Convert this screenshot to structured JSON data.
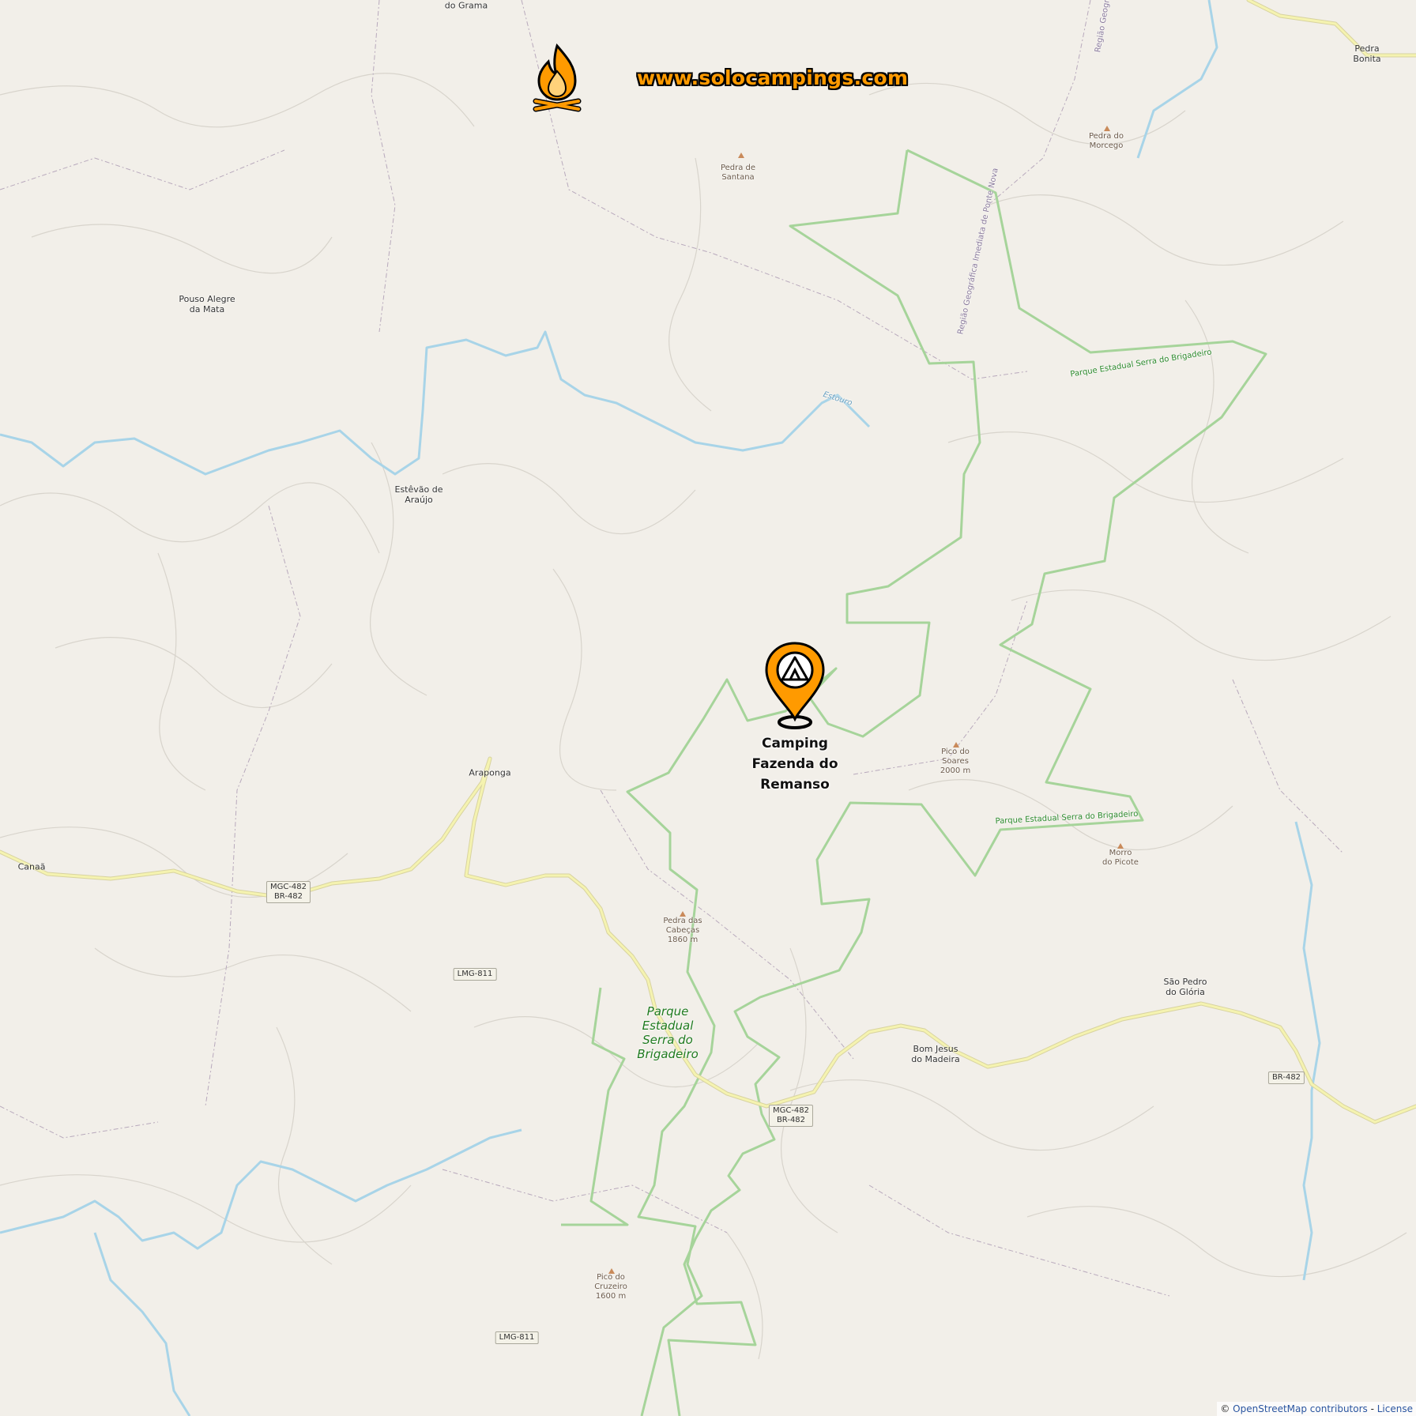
{
  "brand": {
    "url_text": "www.solocampings.com",
    "logo_icon": "campfire-icon"
  },
  "marker": {
    "icon": "tent-location-pin-icon",
    "label_lines": [
      "Camping",
      "Fazenda do",
      "Remanso"
    ]
  },
  "places": {
    "do_grama": "do Grama",
    "pedra_bonita": "Pedra Bonita",
    "pouso_alegre": "Pouso Alegre\nda Mata",
    "estevao": "Estêvão de\nAraújo",
    "araponga": "Araponga",
    "canaa": "Canaã",
    "bom_jesus": "Bom Jesus\ndo Madeira",
    "sao_pedro": "São Pedro\ndo Glória"
  },
  "peaks": {
    "pedra_santana": "Pedra de\nSantana",
    "pedra_morcego": "Pedra do\nMorcego",
    "pico_soares": "Pico do\nSoares\n2000 m",
    "morro_picote": "Morro\ndo Picote",
    "pedra_cabecas": "Pedra das\nCabeças\n1860 m",
    "pico_cruzeiro": "Pico do\nCruzeiro\n1600 m"
  },
  "park_labels": {
    "park_big": "Parque\nEstadual\nSerra do\nBrigadeiro",
    "park_ne": "Parque Estadual Serra do Brigadeiro",
    "park_e": "Parque Estadual Serra do Brigadeiro"
  },
  "water_labels": {
    "river": "Estouro"
  },
  "region_labels": {
    "region_1": "Região Geográfica Imediata de Ponte Nova",
    "region_2": "Região Geográ"
  },
  "road_shields": {
    "mgc_west": "MGC-482\nBR-482",
    "lmg811_north": "LMG-811",
    "mgc_center": "MGC-482\nBR-482",
    "br482_east": "BR-482",
    "lmg811_south": "LMG-811"
  },
  "attribution": {
    "prefix": "© ",
    "osm": "OpenStreetMap contributors",
    "sep": " - ",
    "license": "License"
  },
  "colors": {
    "brand_orange": "#ff9a00",
    "park_boundary": "#a6d49a",
    "river": "#a8d4e8",
    "primary_road": "#f2f0a0",
    "background": "#f2efe9"
  }
}
